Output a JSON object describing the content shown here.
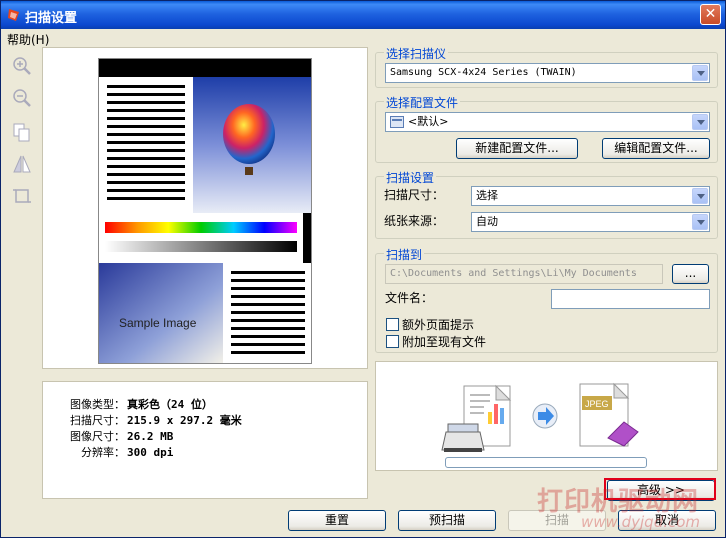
{
  "window": {
    "title": "扫描设置",
    "close_glyph": "✕"
  },
  "menu": {
    "help": "帮助(H)"
  },
  "toolbar": {
    "icons": [
      "zoom-in-icon",
      "zoom-out-icon",
      "rotate-icon",
      "mirror-icon",
      "crop-icon"
    ]
  },
  "preview": {
    "sample_text": "Sample Image"
  },
  "image_info": {
    "type_label": "图像类型：",
    "type_value": "真彩色（24 位）",
    "scan_size_label": "扫描尺寸：",
    "scan_size_value": "215.9 x 297.2 毫米",
    "image_size_label": "图像尺寸：",
    "image_size_value": "26.2 MB",
    "resolution_label": "分辨率：",
    "resolution_value": "300 dpi"
  },
  "select_scanner": {
    "title": "选择扫描仪",
    "value": "Samsung SCX-4x24 Series (TWAIN)"
  },
  "select_profile": {
    "title": "选择配置文件",
    "value": "<默认>",
    "new_button": "新建配置文件...",
    "edit_button": "编辑配置文件..."
  },
  "scan_settings": {
    "title": "扫描设置",
    "size_label": "扫描尺寸：",
    "size_value": "选择",
    "source_label": "纸张来源：",
    "source_value": "自动"
  },
  "scan_to": {
    "title": "扫描到",
    "path_value": "C:\\Documents and Settings\\Li\\My Documents",
    "browse_button": "...",
    "filename_label": "文件名：",
    "filename_value": "",
    "extra_page_prompt": "额外页面提示",
    "append_existing": "附加至现有文件"
  },
  "diagram": {
    "jpeg_label": "JPEG"
  },
  "progress": {
    "value": 0
  },
  "buttons": {
    "advanced": "高级 >>",
    "reset": "重置",
    "prescan": "预扫描",
    "scan": "扫描",
    "cancel": "取消"
  },
  "watermark": {
    "text": "打印机驱动网",
    "url": "www.dyjqd.com"
  },
  "colors": {
    "accent": "#0046d5",
    "title_bar": "#0c48cf",
    "highlight": "#e0001a"
  }
}
